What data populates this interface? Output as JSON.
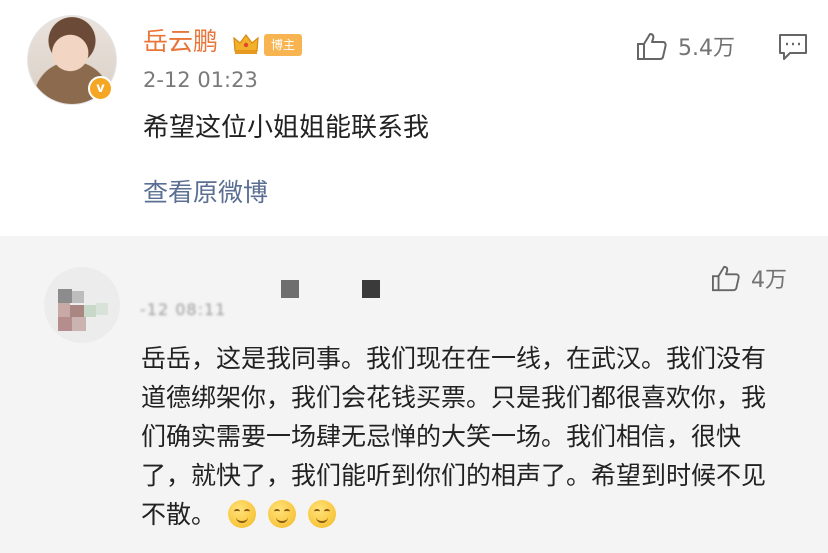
{
  "post": {
    "username": "岳云鹏",
    "badge_label": "博主",
    "timestamp": "2-12 01:23",
    "text": "希望这位小姐姐能联系我",
    "view_original_label": "查看原微博",
    "likes": "5.4万",
    "icons": {
      "like": "thumbs-up-icon",
      "comment": "comment-icon",
      "crown": "crown-icon",
      "verified": "verified-v-icon"
    },
    "verified_letter": "v"
  },
  "reply": {
    "timestamp": "-12 08:11",
    "likes": "4万",
    "text": "岳岳，这是我同事。我们现在在一线，在武汉。我们没有道德绑架你，我们会花钱买票。只是我们都很喜欢你，我们确实需要一场肆无忌惮的大笑一场。我们相信，很快了，就快了，我们能听到你们的相声了。希望到时候不见不散。",
    "emoji_count": 3
  },
  "colors": {
    "username": "#e8753a",
    "link": "#5b6f93",
    "badge": "#f8b450"
  }
}
